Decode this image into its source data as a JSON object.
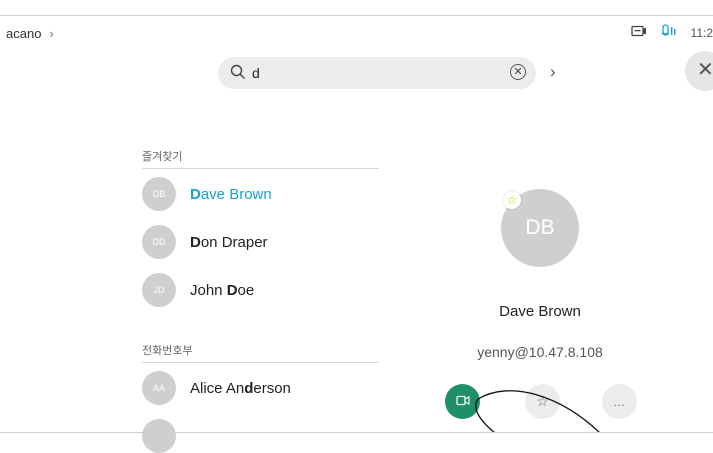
{
  "header": {
    "breadcrumb": "acano",
    "time": "11:2"
  },
  "search": {
    "query": "d"
  },
  "favorites": {
    "title": "즐겨찾기",
    "items": [
      {
        "initials": "DB",
        "name_bold": "D",
        "name_rest": "ave Brown",
        "selected": true
      },
      {
        "initials": "DD",
        "name_bold": "D",
        "name_rest": "on Draper"
      },
      {
        "initials": "JD",
        "name_pre": "John ",
        "name_bold": "D",
        "name_rest": "oe"
      }
    ]
  },
  "directory": {
    "title": "전화번호부",
    "items": [
      {
        "initials": "AA",
        "name_pre": "Alice An",
        "name_bold": "d",
        "name_rest": "erson"
      }
    ]
  },
  "detail": {
    "initials": "DB",
    "name": "Dave Brown",
    "address": "yenny@10.47.8.108",
    "favorite": true,
    "actions": [
      {
        "id": "call",
        "icon": "video-call-icon",
        "label": ""
      },
      {
        "id": "favorite",
        "icon": "star-icon",
        "label": ""
      },
      {
        "id": "more",
        "icon": "more-icon",
        "label": ""
      }
    ]
  },
  "colors": {
    "accent": "#1aa0d6",
    "call": "#1e8f6a",
    "favorite_star": "#f2b400"
  }
}
